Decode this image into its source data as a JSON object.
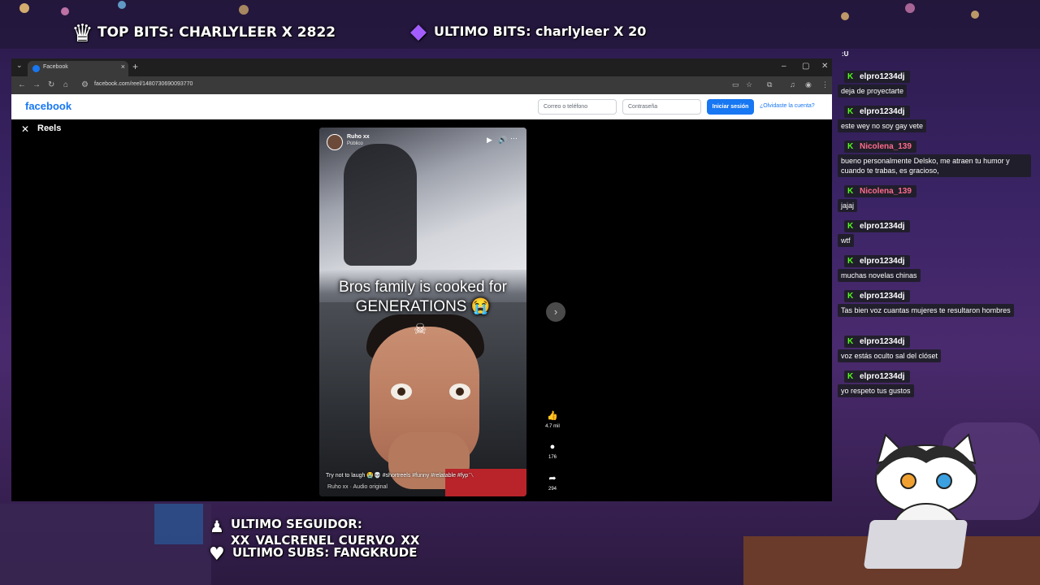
{
  "stream_overlay": {
    "top_bits": "TOP BITS: CHARLYLEER X 2822",
    "last_bits": "ULTIMO BITS: charlyleer X 20",
    "last_follower_label": "ULTIMO SEGUIDOR:",
    "last_follower_name": "XX_VALCRENEL CUERVO_XX",
    "last_sub": "ULTIMO SUBS: FANGKRUDE"
  },
  "browser": {
    "tab_title": "Facebook",
    "url": "facebook.com/reel/1480730690093770"
  },
  "facebook": {
    "logo": "facebook",
    "email_placeholder": "Correo o teléfono",
    "password_placeholder": "Contraseña",
    "login_button": "Iniciar sesión",
    "forgot_link": "¿Olvidaste la cuenta?",
    "reels_title": "Reels"
  },
  "reel": {
    "channel_name": "Ruho xx",
    "visibility": "Público",
    "caption": "Bros family is cooked for GENERATIONS 😭",
    "skull": "☠",
    "description": "Try not to laugh 😭💀 #shortreels #funny #relatable #fyp〽",
    "audio": "Ruho xx · Audio original",
    "likes": "4.7 mil",
    "comments": "176",
    "shares": "294"
  },
  "chat": {
    "header": ":U",
    "messages": [
      {
        "user": "elpro1234dj",
        "color": "#ffffff",
        "text": "deja de proyectarte"
      },
      {
        "user": "elpro1234dj",
        "color": "#ffffff",
        "text": "este wey no soy gay vete"
      },
      {
        "user": "Nicolena_139",
        "color": "#ff6b8a",
        "text": "bueno personalmente Delsko, me atraen tu humor y cuando te trabas, es gracioso,"
      },
      {
        "user": "Nicolena_139",
        "color": "#ff6b8a",
        "text": "jajaj"
      },
      {
        "user": "elpro1234dj",
        "color": "#ffffff",
        "text": "wtf"
      },
      {
        "user": "elpro1234dj",
        "color": "#ffffff",
        "text": "muchas novelas chinas"
      },
      {
        "user": "elpro1234dj",
        "color": "#ffffff",
        "text": "Tas bien voz cuantas mujeres te resultaron hombres"
      },
      {
        "user": "elpro1234dj",
        "color": "#ffffff",
        "text": "voz estás oculto sal del clóset"
      },
      {
        "user": "elpro1234dj",
        "color": "#ffffff",
        "text": "yo respeto tus gustos"
      }
    ]
  }
}
